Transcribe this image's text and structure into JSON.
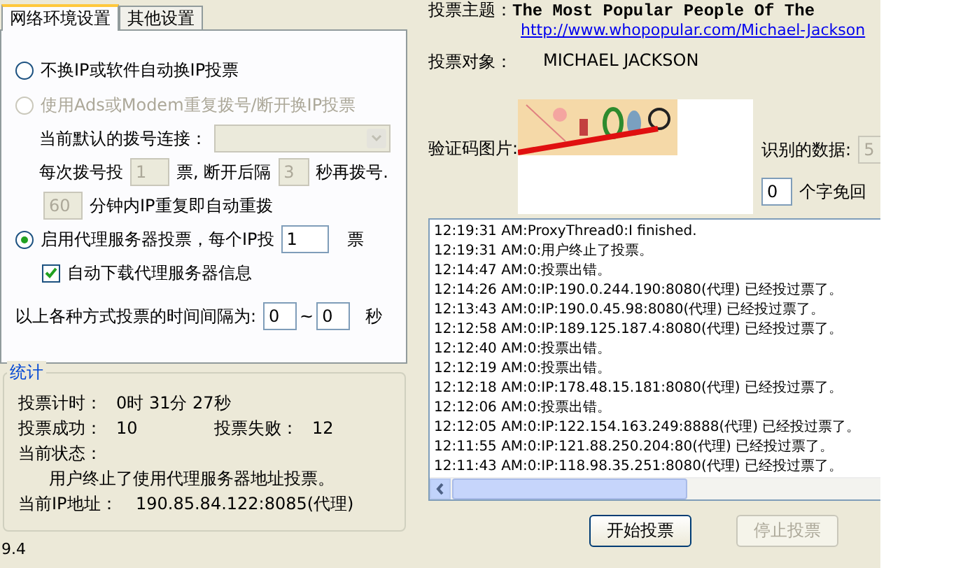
{
  "tabs": [
    {
      "label": "网络环境设置",
      "selected": true
    },
    {
      "label": "其他设置",
      "selected": false
    }
  ],
  "modes": [
    {
      "kind": "plain",
      "label": "不换IP或软件自动换IP投票",
      "selected": false,
      "disabled": false
    },
    {
      "kind": "dial",
      "label": "使用Ads或Modem重复拨号/断开换IP投票",
      "selected": false,
      "disabled": true
    },
    {
      "kind": "proxy",
      "label": "启用代理服务器投票，每个IP投",
      "selected": true,
      "disabled": false
    }
  ],
  "dial": {
    "connection_label": "当前默认的拨号连接：",
    "votes_prefix": "每次拨号投",
    "votes_value": "1",
    "votes_suffix": "票, 断开后隔",
    "wait_value": "3",
    "wait_suffix": "秒再拨号.",
    "minutes_value": "60",
    "minutes_suffix": "分钟内IP重复即自动重拨"
  },
  "proxy": {
    "value": "1",
    "suffix": "票",
    "auto_download": {
      "label": "自动下载代理服务器信息",
      "checked": true
    }
  },
  "interval": {
    "label": "以上各种方式投票的时间间隔为:",
    "from": "0",
    "separator": "~",
    "to": "0",
    "unit": "秒"
  },
  "stats": {
    "title": "统计",
    "timer_label": "投票计时：",
    "timer": "0时 31分 27秒",
    "success_label": "投票成功：",
    "success": "10",
    "fail_label": "投票失败：",
    "fail": "12",
    "status_label": "当前状态：",
    "status": "用户终止了使用代理服务器地址投票。",
    "ip_label": "当前IP地址：",
    "ip": "190.85.84.122:8085(代理)"
  },
  "version": "9.4",
  "vote": {
    "topic_label": "投票主题：",
    "topic": "The Most Popular People Of The",
    "url": "http://www.whopopular.com/Michael-Jackson",
    "target_label": "投票对象：",
    "target": "MICHAEL JACKSON",
    "captcha_label": "验证码图片:",
    "recognized_label": "识别的数据:",
    "recognized": "5",
    "chars_value": "0",
    "chars_label": "个字免回"
  },
  "log": [
    "12:19:31 AM:ProxyThread0:I finished.",
    "12:19:31 AM:0:用户终止了投票。",
    "12:14:47 AM:0:投票出错。",
    "12:14:26 AM:0:IP:190.0.244.190:8080(代理) 已经投过票了。",
    "12:13:43 AM:0:IP:190.0.45.98:8080(代理) 已经投过票了。",
    "12:12:58 AM:0:IP:189.125.187.4:8080(代理) 已经投过票了。",
    "12:12:40 AM:0:投票出错。",
    "12:12:19 AM:0:投票出错。",
    "12:12:18 AM:0:IP:178.48.15.181:8080(代理) 已经投过票了。",
    "12:12:06 AM:0:投票出错。",
    "12:12:05 AM:0:IP:122.154.163.249:8888(代理) 已经投过票了。",
    "12:11:55 AM:0:IP:121.88.250.204:80(代理) 已经投过票了。",
    "12:11:43 AM:0:IP:118.98.35.251:8080(代理) 已经投过票了。"
  ],
  "buttons": [
    {
      "label": "开始投票",
      "disabled": false
    },
    {
      "label": "停止投票",
      "disabled": true
    }
  ]
}
